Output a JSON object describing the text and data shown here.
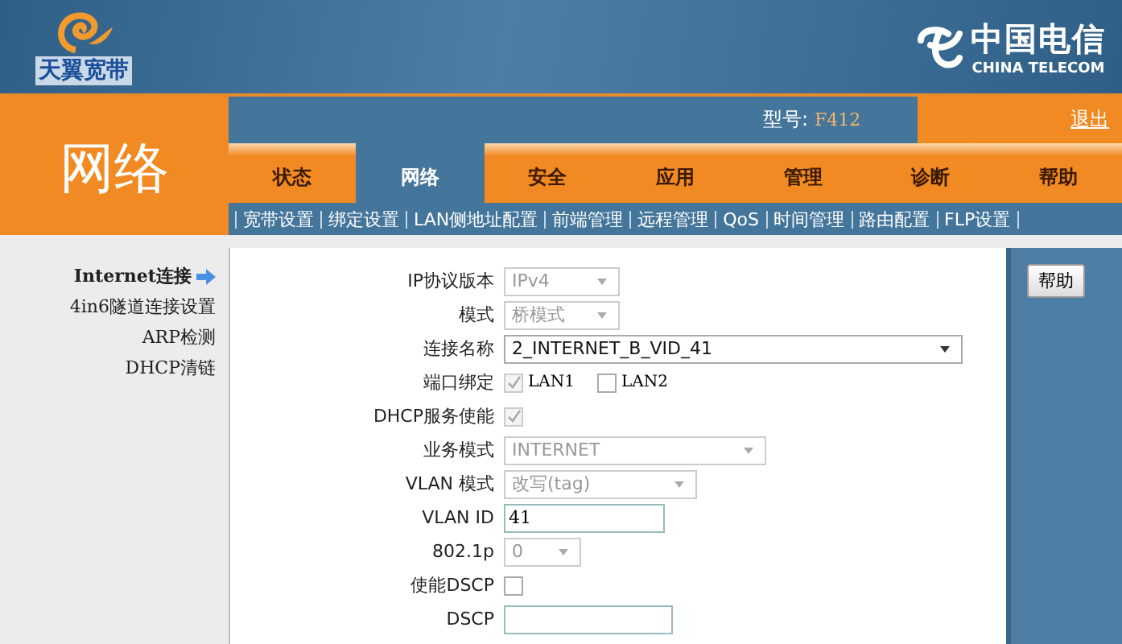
{
  "header": {
    "brand_left": "天翼宽带",
    "brand_right": "中国电信",
    "brand_right_sub": "CHINA TELECOM"
  },
  "section_title": "网络",
  "model_label": "型号:",
  "model_value": "F412",
  "logout": "退出",
  "tabs": [
    {
      "label": "状态",
      "selected": false
    },
    {
      "label": "网络",
      "selected": true
    },
    {
      "label": "安全",
      "selected": false
    },
    {
      "label": "应用",
      "selected": false
    },
    {
      "label": "管理",
      "selected": false
    },
    {
      "label": "诊断",
      "selected": false
    },
    {
      "label": "帮助",
      "selected": false
    }
  ],
  "subnav": [
    "宽带设置",
    "绑定设置",
    "LAN侧地址配置",
    "前端管理",
    "远程管理",
    "QoS",
    "时间管理",
    "路由配置",
    "FLP设置"
  ],
  "sidebar": {
    "items": [
      {
        "label": "Internet连接",
        "selected": true
      },
      {
        "label": "4in6隧道连接设置",
        "selected": false
      },
      {
        "label": "ARP检测",
        "selected": false
      },
      {
        "label": "DHCP清链",
        "selected": false
      }
    ]
  },
  "form": [
    {
      "kind": "select",
      "label": "IP协议版本",
      "value": "IPv4",
      "disabled": true
    },
    {
      "kind": "select",
      "label": "模式",
      "value": "桥模式",
      "disabled": true
    },
    {
      "kind": "select",
      "label": "连接名称",
      "value": "2_INTERNET_B_VID_41",
      "disabled": false
    },
    {
      "kind": "checks",
      "label": "端口绑定",
      "options": [
        {
          "label": "LAN1",
          "checked": true,
          "disabled": true
        },
        {
          "label": "LAN2",
          "checked": false,
          "disabled": false
        }
      ]
    },
    {
      "kind": "check",
      "label": "DHCP服务使能",
      "checked": true,
      "disabled": true
    },
    {
      "kind": "select",
      "label": "业务模式",
      "value": "INTERNET",
      "disabled": true
    },
    {
      "kind": "select",
      "label": "VLAN 模式",
      "value": "改写(tag)",
      "disabled": true
    },
    {
      "kind": "input",
      "label": "VLAN ID",
      "value": "41"
    },
    {
      "kind": "select",
      "label": "802.1p",
      "value": "0",
      "disabled": true
    },
    {
      "kind": "check",
      "label": "使能DSCP",
      "checked": false,
      "disabled": false
    },
    {
      "kind": "input",
      "label": "DSCP"
    }
  ],
  "help_button": "帮助"
}
